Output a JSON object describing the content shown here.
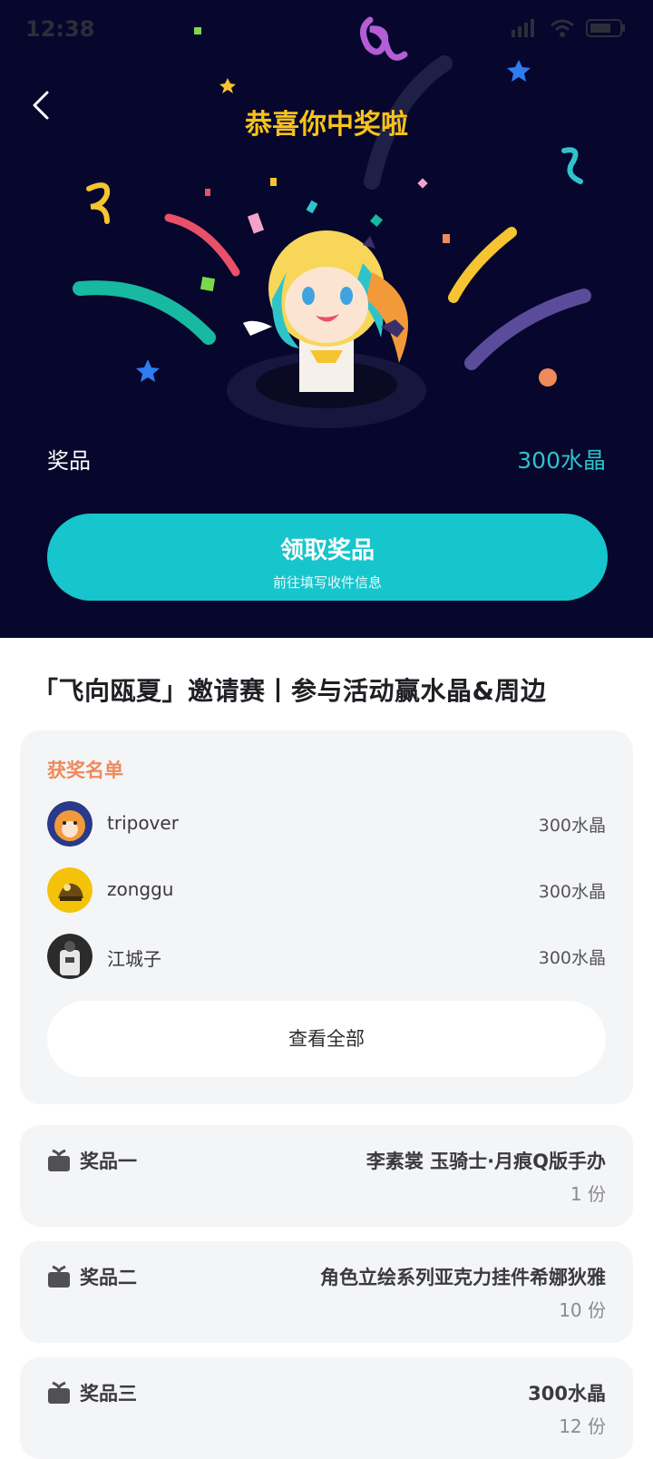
{
  "status": {
    "time": "12:38"
  },
  "hero": {
    "title": "恭喜你中奖啦",
    "prize_label": "奖品",
    "prize_value": "300水晶",
    "claim_main": "领取奖品",
    "claim_sub": "前往填写收件信息"
  },
  "event_title": "「飞向瓯夏」邀请赛丨参与活动赢水晶&周边",
  "winners": {
    "heading": "获奖名单",
    "list": [
      {
        "name": "tripover",
        "amount": "300水晶"
      },
      {
        "name": "zonggu",
        "amount": "300水晶"
      },
      {
        "name": "江城子",
        "amount": "300水晶"
      }
    ],
    "view_all": "查看全部"
  },
  "prizes": [
    {
      "label": "奖品一",
      "name": "李素裳 玉骑士·月痕Q版手办",
      "count": "1 份"
    },
    {
      "label": "奖品二",
      "name": "角色立绘系列亚克力挂件希娜狄雅",
      "count": "10 份"
    },
    {
      "label": "奖品三",
      "name": "300水晶",
      "count": "12 份"
    }
  ],
  "colors": {
    "hero_bg": "#07062c",
    "accent": "#17c5cc",
    "title_yellow": "#f7c21a",
    "heading_orange": "#f08a5a"
  }
}
